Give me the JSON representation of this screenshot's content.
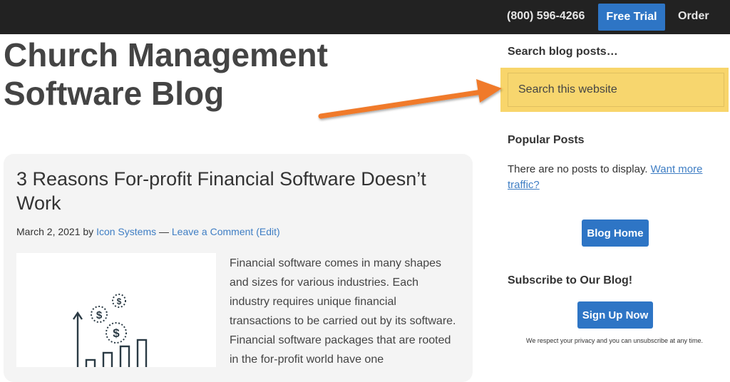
{
  "header": {
    "phone": "(800) 596-4266",
    "free_trial_label": "Free Trial",
    "order_label": "Order"
  },
  "blog": {
    "title": "Church Management Software Blog"
  },
  "post": {
    "title": "3 Reasons For-profit Financial Software Doesn’t Work",
    "date": "March 2, 2021",
    "by": "by",
    "author": "Icon Systems",
    "separator": "—",
    "comment_link": "Leave a Comment",
    "edit_link": "(Edit)",
    "excerpt": "Financial software comes in many shapes and sizes for various industries. Each industry requires unique financial transactions to be carried out by its software. Financial software packages that are rooted in the for-profit world have one"
  },
  "sidebar": {
    "search_heading": "Search blog posts…",
    "search_placeholder": "Search this website",
    "popular_heading": "Popular Posts",
    "popular_text": "There are no posts to display.",
    "popular_link": "Want more traffic?",
    "blog_home_label": "Blog Home",
    "subscribe_heading": "Subscribe to Our Blog!",
    "signup_label": "Sign Up Now",
    "privacy_note": "We respect your privacy and you can unsubscribe at any time."
  },
  "colors": {
    "topbar": "#222222",
    "accent_blue": "#2e75c5",
    "highlight_yellow": "#f8d56b",
    "arrow_orange": "#f07a2a"
  },
  "icons": [
    "dollar-coin-icon",
    "growth-chart-icon",
    "arrow-annotation"
  ]
}
